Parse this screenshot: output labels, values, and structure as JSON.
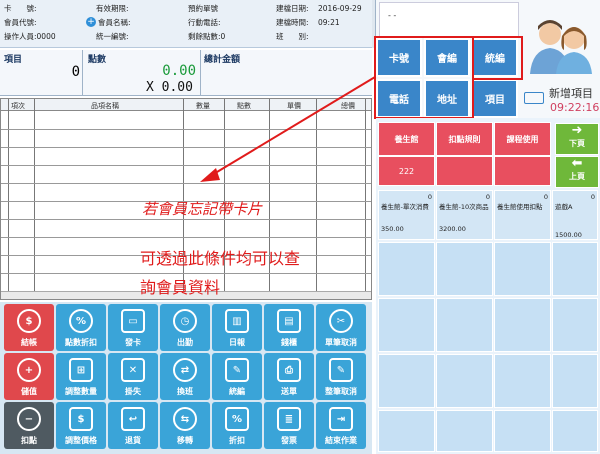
{
  "info": {
    "card_no": "卡　　號:",
    "valid_period": "有效期限:",
    "display_value": "- -",
    "reservation_no": "預約單號",
    "created_date_label": "建檔日期:",
    "created_date": "2016-09-29",
    "member_id": "會員代號:",
    "member_name": "會員名稱:",
    "mobile": "行動電話:",
    "created_time_label": "建檔時間:",
    "created_time": "09:21",
    "operator": "操作人員:0000",
    "unified_no": "統一編號:",
    "remaining_points": "剩餘點數:0",
    "shift": "班　　別:"
  },
  "totals": {
    "item_label": "項目",
    "item_value": "0",
    "points_label": "點數",
    "points_value": "0.00",
    "multiplier": "X 0.00",
    "amount_label": "總計金額"
  },
  "grid": {
    "columns": [
      "項次",
      "品項名稱",
      "數量",
      "點數",
      "單價",
      "總價"
    ]
  },
  "annotations": {
    "line1": "若會員忘記帶卡片",
    "line2": "可透過此條件均可以查",
    "line3": "詢會員資料"
  },
  "keypad": {
    "card_no": "卡號",
    "member_no": "會編",
    "unified_no": "統編",
    "phone": "電話",
    "address": "地址",
    "item": "項目"
  },
  "header_right": {
    "new_item": "新增項目",
    "time": "09:22:16"
  },
  "right_panel": {
    "tabs": [
      "養生館",
      "扣點規則",
      "課程使用"
    ],
    "value_222": "222",
    "next_page": "下頁",
    "prev_page": "上頁",
    "products": [
      {
        "name": "養生館-單次消費",
        "flag": "0",
        "price": "350.00"
      },
      {
        "name": "養生館-10次商品",
        "flag": "0",
        "price": "3200.00"
      },
      {
        "name": "養生館使用扣點",
        "flag": "0",
        "price": ""
      },
      {
        "name": "遊戲A",
        "flag": "0",
        "price": "1500.00"
      }
    ]
  },
  "buttons": {
    "checkout": "結帳",
    "points_discount": "點數折扣",
    "issue_card": "發卡",
    "clock_out": "出勤",
    "daily_report": "日報",
    "cash_drawer": "錢櫃",
    "cancel_item": "單筆取消",
    "topup": "儲值",
    "adjust_qty": "調整數量",
    "report_lost": "掛失",
    "exchange": "換班",
    "unified_no": "統編",
    "send_order": "送單",
    "cancel_whole": "整筆取消",
    "deduct_points": "扣點",
    "adjust_price": "調整價格",
    "return_goods": "退貨",
    "transfer": "移轉",
    "discount": "折扣",
    "invoice": "發票",
    "end_job": "結束作業"
  }
}
